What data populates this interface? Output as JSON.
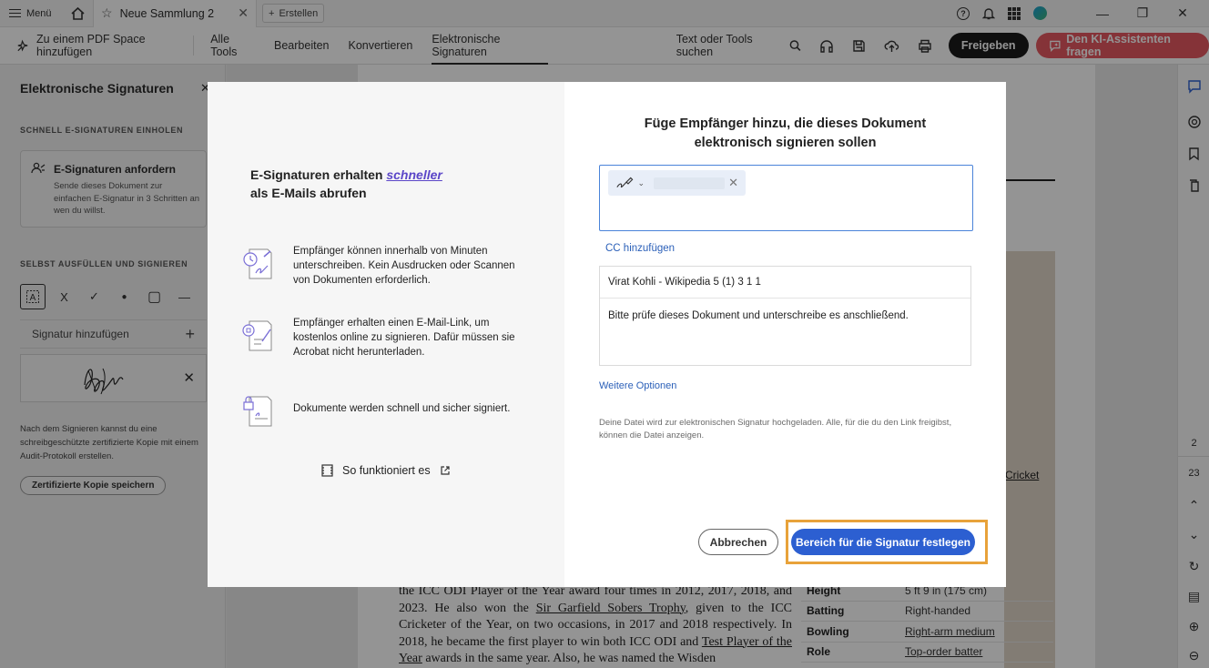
{
  "titlebar": {
    "menu_label": "Menü",
    "tab_title": "Neue Sammlung 2",
    "new_tab_label": "Erstellen"
  },
  "toolbar": {
    "add_space_label": "Zu einem PDF Space hinzufügen",
    "nav": [
      "Alle Tools",
      "Bearbeiten",
      "Konvertieren",
      "Elektronische Signaturen"
    ],
    "search_label": "Text oder Tools suchen",
    "share_label": "Freigeben",
    "ai_label": "Den KI-Assistenten fragen"
  },
  "left_panel": {
    "title": "Elektronische Signaturen",
    "section_quick": "SCHNELL E-SIGNATUREN EINHOLEN",
    "card_title": "E-Signaturen anfordern",
    "card_desc": "Sende dieses Dokument zur einfachen E-Signatur in 3 Schritten an wen du willst.",
    "section_self": "SELBST AUSFÜLLEN UND SIGNIEREN",
    "tools": [
      "X",
      "✓",
      "●",
      "▢",
      "—"
    ],
    "add_signature": "Signatur hinzufügen",
    "note": "Nach dem Signieren kannst du eine schreibgeschützte zertifizierte Kopie mit einem Audit-Protokoll erstellen.",
    "save_copy_button": "Zertifizierte Kopie speichern"
  },
  "document": {
    "text_parts": [
      "the ICC ODI Player of the Year award four times in 2012, 2017, 2018, and 2023. He also won the ",
      "Sir Garfield Sobers Trophy",
      ", given to the ICC Cricketer of the Year, on two occasions, in 2017 and 2018 respectively. In 2018, he became the first player to win both ICC ODI and ",
      "Test Player of the Year",
      " awards in the same year. Also, he was named the Wisden"
    ],
    "cricket_link": "Cricket",
    "infobox": [
      {
        "k": "Height",
        "v": "5 ft 9 in (175 cm)"
      },
      {
        "k": "Batting",
        "v": "Right-handed"
      },
      {
        "k": "Bowling",
        "v": "Right-arm medium"
      },
      {
        "k": "Role",
        "v": "Top-order batter"
      }
    ],
    "page_current": "2",
    "page_total": "23"
  },
  "dialog": {
    "headline_part1": "E-Signaturen erhalten ",
    "headline_emph": "schneller",
    "headline_part2": "als E-Mails abrufen",
    "features": [
      "Empfänger können innerhalb von Minuten unterschreiben. Kein Ausdrucken oder Scannen von Dokumenten erforderlich.",
      "Empfänger erhalten einen E-Mail-Link, um kostenlos online zu signieren. Dafür müssen sie Acrobat nicht herunterladen.",
      "Dokumente werden schnell und sicher signiert."
    ],
    "how_it_works": "So funktioniert es",
    "title": "Füge Empfänger hinzu, die dieses Dokument elektronisch signieren sollen",
    "cc_label": "CC hinzufügen",
    "subject": "Virat Kohli - Wikipedia 5 (1) 3 1 1",
    "message": "Bitte prüfe dieses Dokument und unterschreibe es anschließend.",
    "more_options": "Weitere Optionen",
    "disclaimer": "Deine Datei wird zur elektronischen Signatur hochgeladen. Alle, für die du den Link freigibst, können die Datei anzeigen.",
    "cancel_label": "Abbrechen",
    "primary_label": "Bereich für die Signatur festlegen"
  }
}
